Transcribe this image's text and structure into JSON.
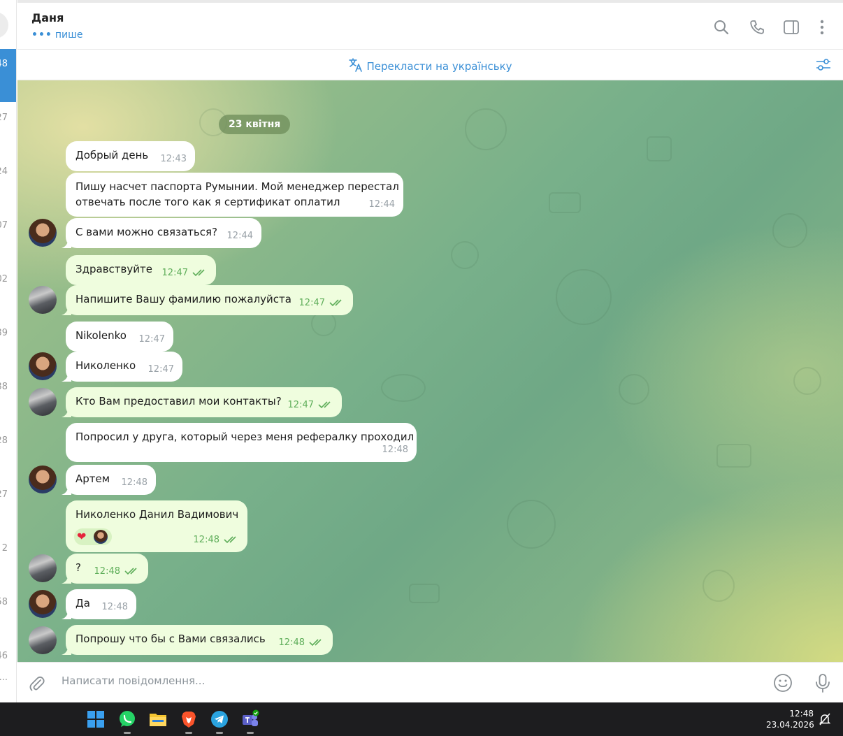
{
  "sidebar": {
    "counters": [
      "48",
      "27",
      "24",
      "07",
      "02",
      "39",
      "38",
      "28",
      "27",
      "2",
      "58",
      "46",
      "..."
    ]
  },
  "header": {
    "title": "Даня",
    "status": "пише",
    "status_dots": "•••"
  },
  "translate_bar": {
    "label": "Перекласти на українську"
  },
  "chat": {
    "date_separator": "23 квітня",
    "messages": [
      {
        "dir": "in",
        "text": "Добрый день",
        "time": "12:43"
      },
      {
        "dir": "in",
        "text": "Пишу насчет паспорта Румынии. Мой менеджер перестал",
        "text2": "отвечать после того как я сертификат оплатил",
        "time": "12:44"
      },
      {
        "dir": "in",
        "text": "С вами можно связаться?",
        "time": "12:44"
      },
      {
        "dir": "out",
        "text": "Здравствуйте",
        "time": "12:47"
      },
      {
        "dir": "out",
        "text": "Напишите Вашу фамилию пожалуйста",
        "time": "12:47"
      },
      {
        "dir": "in",
        "text": "Nikolenko",
        "time": "12:47"
      },
      {
        "dir": "in",
        "text": "Николенко",
        "time": "12:47"
      },
      {
        "dir": "out",
        "text": "Кто Вам предоставил мои контакты?",
        "time": "12:47"
      },
      {
        "dir": "in",
        "text": "Попросил у друга, который через меня рефералку проходил",
        "time": "12:48"
      },
      {
        "dir": "in",
        "text": "Артем",
        "time": "12:48"
      },
      {
        "dir": "out",
        "text": "Николенко Данил Вадимович",
        "time": "12:48",
        "reaction": "heart"
      },
      {
        "dir": "out",
        "text": "?",
        "time": "12:48"
      },
      {
        "dir": "in",
        "text": "Да",
        "time": "12:48"
      },
      {
        "dir": "out",
        "text": "Попрошу что бы с Вами связались",
        "time": "12:48"
      }
    ]
  },
  "composer": {
    "placeholder": "Написати повідомлення..."
  },
  "taskbar": {
    "apps": [
      "windows-start",
      "whatsapp",
      "file-explorer",
      "brave",
      "telegram",
      "teams"
    ],
    "time": "12:48",
    "date": "23.04.2026"
  },
  "colors": {
    "accent": "#3a8fd6",
    "outgoing_bubble": "#effdde",
    "outgoing_meta": "#5fae5a",
    "incoming_bubble": "#ffffff"
  }
}
